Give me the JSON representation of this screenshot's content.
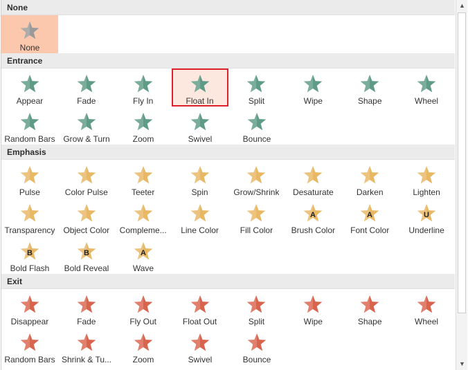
{
  "sections": [
    {
      "key": "none",
      "title": "None",
      "items": [
        {
          "label": "None",
          "icon": "star-icon",
          "selected": true
        }
      ]
    },
    {
      "key": "entrance",
      "title": "Entrance",
      "items": [
        {
          "label": "Appear",
          "icon": "appear-star-icon"
        },
        {
          "label": "Fade",
          "icon": "fade-star-icon"
        },
        {
          "label": "Fly In",
          "icon": "fly-in-star-icon"
        },
        {
          "label": "Float In",
          "icon": "float-in-star-icon",
          "focused": true
        },
        {
          "label": "Split",
          "icon": "split-star-icon"
        },
        {
          "label": "Wipe",
          "icon": "wipe-star-icon"
        },
        {
          "label": "Shape",
          "icon": "shape-star-icon"
        },
        {
          "label": "Wheel",
          "icon": "wheel-star-icon"
        },
        {
          "label": "Random Bars",
          "icon": "random-bars-star-icon"
        },
        {
          "label": "Grow & Turn",
          "icon": "grow-turn-star-icon"
        },
        {
          "label": "Zoom",
          "icon": "zoom-star-icon"
        },
        {
          "label": "Swivel",
          "icon": "swivel-star-icon"
        },
        {
          "label": "Bounce",
          "icon": "bounce-star-icon"
        }
      ]
    },
    {
      "key": "emphasis",
      "title": "Emphasis",
      "items": [
        {
          "label": "Pulse",
          "icon": "pulse-star-icon"
        },
        {
          "label": "Color Pulse",
          "icon": "color-pulse-star-icon"
        },
        {
          "label": "Teeter",
          "icon": "teeter-star-icon"
        },
        {
          "label": "Spin",
          "icon": "spin-star-icon"
        },
        {
          "label": "Grow/Shrink",
          "icon": "grow-shrink-star-icon"
        },
        {
          "label": "Desaturate",
          "icon": "desaturate-star-icon"
        },
        {
          "label": "Darken",
          "icon": "darken-star-icon"
        },
        {
          "label": "Lighten",
          "icon": "lighten-star-icon"
        },
        {
          "label": "Transparency",
          "icon": "transparency-star-icon"
        },
        {
          "label": "Object Color",
          "icon": "object-color-star-icon"
        },
        {
          "label": "Compleme...",
          "icon": "complementary-color-star-icon"
        },
        {
          "label": "Line Color",
          "icon": "line-color-star-icon"
        },
        {
          "label": "Fill Color",
          "icon": "fill-color-star-icon"
        },
        {
          "label": "Brush Color",
          "icon": "brush-color-star-icon",
          "letter": "A"
        },
        {
          "label": "Font Color",
          "icon": "font-color-star-icon",
          "letter": "A"
        },
        {
          "label": "Underline",
          "icon": "underline-star-icon",
          "letter": "U"
        },
        {
          "label": "Bold Flash",
          "icon": "bold-flash-star-icon",
          "letter": "B"
        },
        {
          "label": "Bold Reveal",
          "icon": "bold-reveal-star-icon",
          "letter": "B"
        },
        {
          "label": "Wave",
          "icon": "wave-star-icon",
          "letter": "A"
        }
      ]
    },
    {
      "key": "exit",
      "title": "Exit",
      "items": [
        {
          "label": "Disappear",
          "icon": "disappear-star-icon"
        },
        {
          "label": "Fade",
          "icon": "fade-star-icon"
        },
        {
          "label": "Fly Out",
          "icon": "fly-out-star-icon"
        },
        {
          "label": "Float Out",
          "icon": "float-out-star-icon"
        },
        {
          "label": "Split",
          "icon": "split-star-icon"
        },
        {
          "label": "Wipe",
          "icon": "wipe-star-icon"
        },
        {
          "label": "Shape",
          "icon": "shape-star-icon"
        },
        {
          "label": "Wheel",
          "icon": "wheel-star-icon"
        },
        {
          "label": "Random Bars",
          "icon": "random-bars-star-icon"
        },
        {
          "label": "Shrink & Tu...",
          "icon": "shrink-turn-star-icon"
        },
        {
          "label": "Zoom",
          "icon": "zoom-star-icon"
        },
        {
          "label": "Swivel",
          "icon": "swivel-star-icon"
        },
        {
          "label": "Bounce",
          "icon": "bounce-star-icon"
        }
      ]
    }
  ],
  "colors": {
    "none": "#9a9a9a",
    "entrance": "#5f9b86",
    "emphasis": "#e8b865",
    "exit": "#d9644d",
    "selected_bg": "#fbc8ad",
    "focus_border": "#e0202b"
  },
  "scrollbar": {
    "up_icon": "▲",
    "down_icon": "▼"
  }
}
